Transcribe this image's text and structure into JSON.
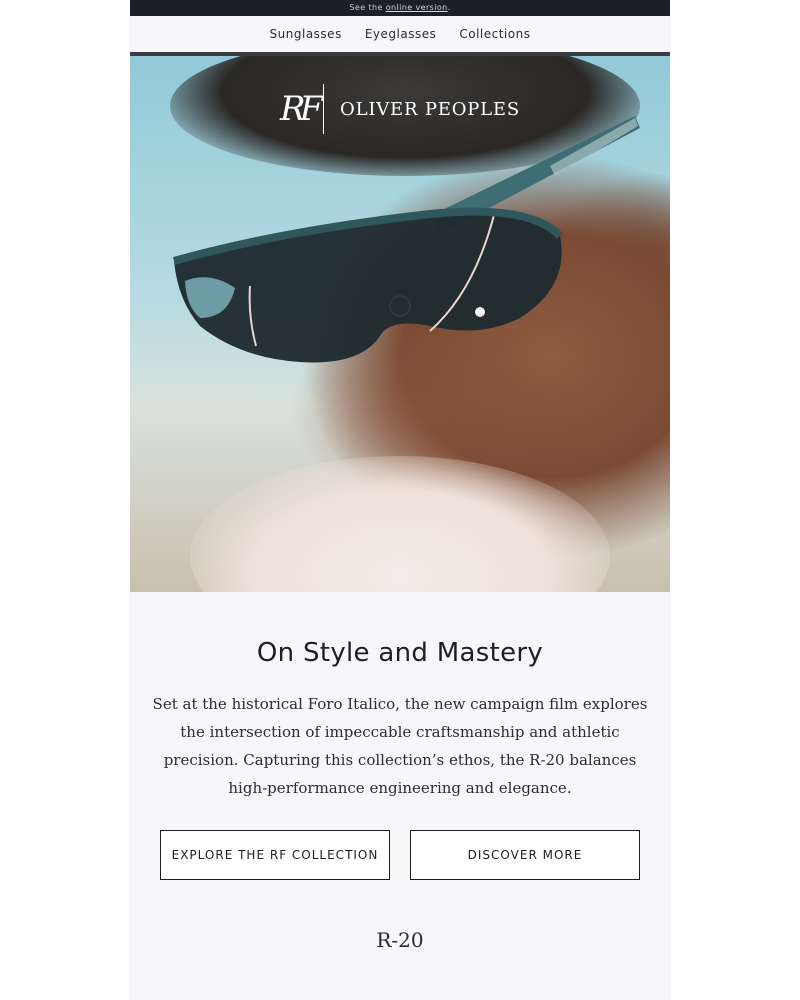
{
  "topbar": {
    "prefix": "See the ",
    "link": "online version",
    "suffix": "."
  },
  "nav": {
    "items": [
      "Sunglasses",
      "Eyeglasses",
      "Collections"
    ]
  },
  "hero": {
    "logo_mark": "RF",
    "brand": "OLIVER PEOPLES"
  },
  "main": {
    "title": "On Style and Mastery",
    "body": "Set at the historical Foro Italico, the new campaign film explores the intersection of impeccable craftsmanship and athletic precision. Capturing this collection’s ethos, the R-20 balances high-performance engineering and elegance.",
    "buttons": [
      "EXPLORE THE RF COLLECTION",
      "DISCOVER MORE"
    ]
  },
  "product": {
    "name": "R-20"
  },
  "colors": {
    "topbar_bg": "#1d1f24",
    "email_bg": "#f7f7f9",
    "text": "#1f1f22"
  }
}
